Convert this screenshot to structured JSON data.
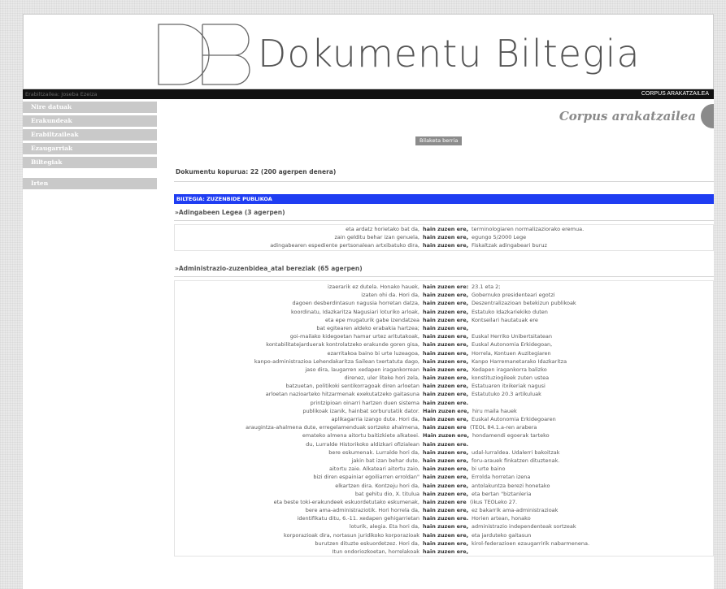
{
  "header": {
    "logo_text": "Dokumentu Biltegia",
    "user_label": "Erabiltzailea: Joseba Ezeiza",
    "section_label": "CORPUS ARAKATZAILEA"
  },
  "sidebar": {
    "items": [
      "Nire datuak",
      "Erakundeak",
      "Erabiltzaileak",
      "Ezaugarriak",
      "Biltegiak"
    ],
    "exit_label": "Irten"
  },
  "main": {
    "title": "Corpus arakatzailea",
    "new_search_label": "Bilaketa berria",
    "doc_count": "Dokumentu kopurua: 22 (200 agerpen denera)",
    "biltegia": "BILTEGIA: ZUZENBIDE PUBLIKOA"
  },
  "documents": [
    {
      "title": "»Adingabeen Legea (3 agerpen)",
      "rows": [
        {
          "left": "eta ardatz horietako bat da,",
          "kw": "hain zuzen ere,",
          "right": "terminologiaren normalizaziorako eremua."
        },
        {
          "left": "zain gelditu behar izan genuela,",
          "kw": "hain zuzen ere,",
          "right": "egungo 5/2000 Lege"
        },
        {
          "left": "adingabearen espediente pertsonalean artxibatuko dira,",
          "kw": "hain zuzen ere,",
          "right": "Fiskaltzak adingabeari buruz"
        }
      ]
    },
    {
      "title": "»Administrazio-zuzenbidea_atal bereziak (65 agerpen)",
      "rows": [
        {
          "left": "izaerarik ez dutela. Honako hauek,",
          "kw": "hain zuzen ere:",
          "right": "23.1 eta 2;"
        },
        {
          "left": "izaten ohi da. Hori da,",
          "kw": "hain zuzen ere,",
          "right": "Gobernuko presidenteari egotzi"
        },
        {
          "left": "dagoen desberdintasun nagusia horretan datza,",
          "kw": "hain zuzen ere,",
          "right": "Deszentralizazioan betekizun publikoak"
        },
        {
          "left": "koordinatu, Idazkaritza Nagusiari loturiko arloak,",
          "kw": "hain zuzen ere,",
          "right": "Estatuko Idazkariekiko duten"
        },
        {
          "left": "eta epe mugaturik gabe izendatzea",
          "kw": "hain zuzen ere,",
          "right": "Kontseilari hautatuak ere"
        },
        {
          "left": "bat egitearen aldeko erabakia hartzea;",
          "kw": "hain zuzen ere,",
          "right": ""
        },
        {
          "left": "goi-mailako kidegoetan hamar urtez aritutakoak,",
          "kw": "hain zuzen ere,",
          "right": "Euskal Herriko Unibertsitatean"
        },
        {
          "left": "kontabilitatejarduerak kontrolatzeko erakunde goren gisa,",
          "kw": "hain zuzen ere,",
          "right": "Euskal Autonomia Erkidegoan,"
        },
        {
          "left": "ezarritakoa baino bi urte luzeagoa,",
          "kw": "hain zuzen ere,",
          "right": "Horrela, Kontuen Auzitegiaren"
        },
        {
          "left": "kanpo-administrazioa Lehendakaritza Sailean txertatuta dago,",
          "kw": "hain zuzen ere,",
          "right": "Kanpo Harremanetarako Idazkaritza"
        },
        {
          "left": "jaso dira, laugarren xedapen iragankorrean",
          "kw": "hain zuzen ere,",
          "right": "Xedapen iragankorra balizko"
        },
        {
          "left": "direnez, uler liteke hori zela,",
          "kw": "hain zuzen ere,",
          "right": "konstituziogileek zuten ustea"
        },
        {
          "left": "batzuetan, politikoki sentikorragoak diren arloetan",
          "kw": "hain zuzen ere,",
          "right": "Estatuaren itxikeriak nagusi"
        },
        {
          "left": "arloetan nazioarteko hitzarmenak exekutatzeko gaitasuna",
          "kw": "hain zuzen ere,",
          "right": "Estatutuko 20.3 artikuluak"
        },
        {
          "left": "printzipioan oinarri hartzen duen sistema",
          "kw": "hain zuzen ere.",
          "right": ""
        },
        {
          "left": "publikoak izanik, hainbat sorburutatik dator.",
          "kw": "Hain zuzen ere,",
          "right": "hiru maila hauek"
        },
        {
          "left": "aplikagarria izango dute. Hori da,",
          "kw": "hain zuzen ere,",
          "right": "Euskal Autonomia Erkidegoaren"
        },
        {
          "left": "araugintza-ahalmena dute, erregelamenduak sortzeko ahalmena,",
          "kw": "hain zuzen ere",
          "right": "(TEOL 84.1.a-ren arabera"
        },
        {
          "left": "emateko almena aitortu baitizkiete alkateei.",
          "kw": "Hain zuzen ere,",
          "right": "hondamendi egoerak tarteko"
        },
        {
          "left": "du, Lurralde Historikoko aldizkari ofizialean",
          "kw": "hain zuzen ere.",
          "right": ""
        },
        {
          "left": "bere eskumenak. Lurralde hori da,",
          "kw": "hain zuzen ere,",
          "right": "udal-lurraldea. Udalerri bakoitzak"
        },
        {
          "left": "jakin bat izan behar dute,",
          "kw": "hain zuzen ere,",
          "right": "foru-arauek finkatzen dituztenak."
        },
        {
          "left": "aitortu zaie. Alkateari aitortu zaio,",
          "kw": "hain zuzen ere,",
          "right": "bi urte baino"
        },
        {
          "left": "bizi diren espainiar egoiliarren erroldan\"",
          "kw": "hain zuzen ere,",
          "right": "Errolda horretan izena"
        },
        {
          "left": "elkartzen dira. Kontzeju hori da,",
          "kw": "hain zuzen ere,",
          "right": "antolakuntza berezi honetako"
        },
        {
          "left": "bat gehitu dio, X. titulua",
          "kw": "hain zuzen ere,",
          "right": "eta bertan \"biztanleria"
        },
        {
          "left": "eta beste toki-erakundeek eskuordetutako eskumenak,",
          "kw": "hain zuzen ere",
          "right": "(ikus TEOLeko 27."
        },
        {
          "left": "bere ama-administraziotik. Hori horrela da,",
          "kw": "hain zuzen ere,",
          "right": "ez bakarrik ama-administrazioak"
        },
        {
          "left": "identifikatu ditu, 6.-11. xedapen gehigarrietan",
          "kw": "hain zuzen ere.",
          "right": "Horien artean, honako"
        },
        {
          "left": "loturik, alegia. Eta hori da,",
          "kw": "hain zuzen ere,",
          "right": "administrazio independenteak sortzeak"
        },
        {
          "left": "korporazioak dira, nortasun juridikoko korporazioak",
          "kw": "hain zuzen ere,",
          "right": "eta jarduteko gaitasun"
        },
        {
          "left": "burutzen dituzte eskuordetzez. Hori da,",
          "kw": "hain zuzen ere,",
          "right": "kirol-federazioen ezaugarririk nabarmenena."
        },
        {
          "left": "Itun ondoriozkoetan, horrelakoak",
          "kw": "hain zuzen ere,",
          "right": ""
        }
      ]
    }
  ]
}
